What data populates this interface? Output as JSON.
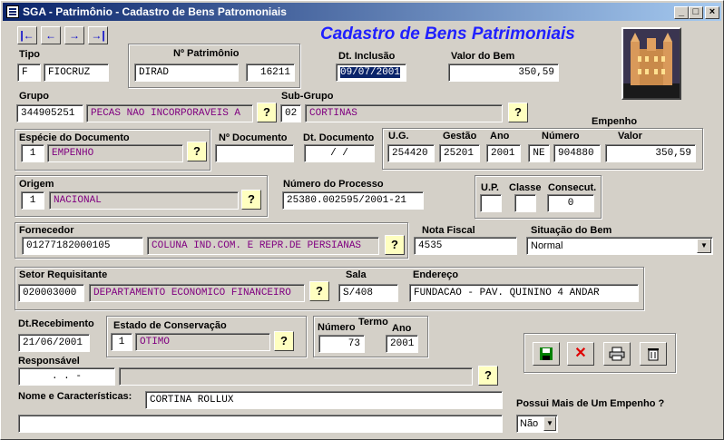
{
  "window": {
    "title": "SGA - Patrimônio - Cadastro de Bens Patromoniais"
  },
  "heading": "Cadastro de Bens Patrimoniais",
  "nav": {
    "first": "|←",
    "prev": "←",
    "next": "→",
    "last": "→|"
  },
  "labels": {
    "tipo": "Tipo",
    "patrimonio": "Nº Patrimônio",
    "dt_inclusao": "Dt. Inclusão",
    "valor_bem": "Valor do Bem",
    "grupo": "Grupo",
    "subgrupo": "Sub-Grupo",
    "empenho": "Empenho",
    "especie": "Espécie do Documento",
    "n_documento": "Nº Documento",
    "dt_documento": "Dt. Documento",
    "ug": "U.G.",
    "gestao": "Gestão",
    "ano": "Ano",
    "numero": "Número",
    "valor": "Valor",
    "origem": "Origem",
    "num_processo": "Número do Processo",
    "up": "U.P.",
    "classe": "Classe",
    "consecut": "Consecut.",
    "fornecedor": "Fornecedor",
    "nota_fiscal": "Nota Fiscal",
    "situacao": "Situação do Bem",
    "setor": "Setor Requisitante",
    "sala": "Sala",
    "endereco": "Endereço",
    "dt_recebimento": "Dt.Recebimento",
    "estado": "Estado de Conservação",
    "termo": "Termo",
    "termo_numero": "Número",
    "termo_ano": "Ano",
    "responsavel": "Responsável",
    "nome": "Nome e Características:",
    "mais_empenho": "Possui Mais de Um Empenho ?"
  },
  "values": {
    "tipo_code": "F",
    "tipo_name": "FIOCRUZ",
    "patrimonio_sigla": "DIRAD",
    "patrimonio_num": "16211",
    "dt_inclusao": "09/07/2001",
    "valor_bem": "350,59",
    "grupo_code": "344905251",
    "grupo_name": "PECAS NAO INCORPORAVEIS A",
    "subgrupo_code": "02",
    "subgrupo_name": "CORTINAS",
    "especie_code": "1",
    "especie_name": "EMPENHO",
    "n_documento": "",
    "dt_documento": "/ /",
    "ug": "254420",
    "gestao": "25201",
    "ano": "2001",
    "ne": "NE",
    "numero": "904880",
    "valor": "350,59",
    "origem_code": "1",
    "origem_name": "NACIONAL",
    "num_processo": "25380.002595/2001-21",
    "up": "",
    "classe": "",
    "consecut": "0",
    "fornecedor_code": "01277182000105",
    "fornecedor_name": "COLUNA IND.COM. E REPR.DE PERSIANAS",
    "nota_fiscal": "4535",
    "situacao": "Normal",
    "setor_code": "020003000",
    "setor_name": "DEPARTAMENTO ECONOMICO FINANCEIRO",
    "sala": "S/408",
    "endereco": "FUNDACAO - PAV. QUININO  4 ANDAR",
    "dt_recebimento": "21/06/2001",
    "estado_code": "1",
    "estado_name": "OTIMO",
    "termo_numero": "73",
    "termo_ano": "2001",
    "responsavel_code": ". .  -",
    "responsavel_name": "",
    "nome": "CORTINA ROLLUX",
    "nome_extra": "",
    "mais_empenho": "Não"
  },
  "lookup_glyph": "?",
  "icons": {
    "save": "save-disk-icon",
    "cancel": "cancel-x-icon",
    "print": "printer-icon",
    "delete": "trash-icon"
  }
}
